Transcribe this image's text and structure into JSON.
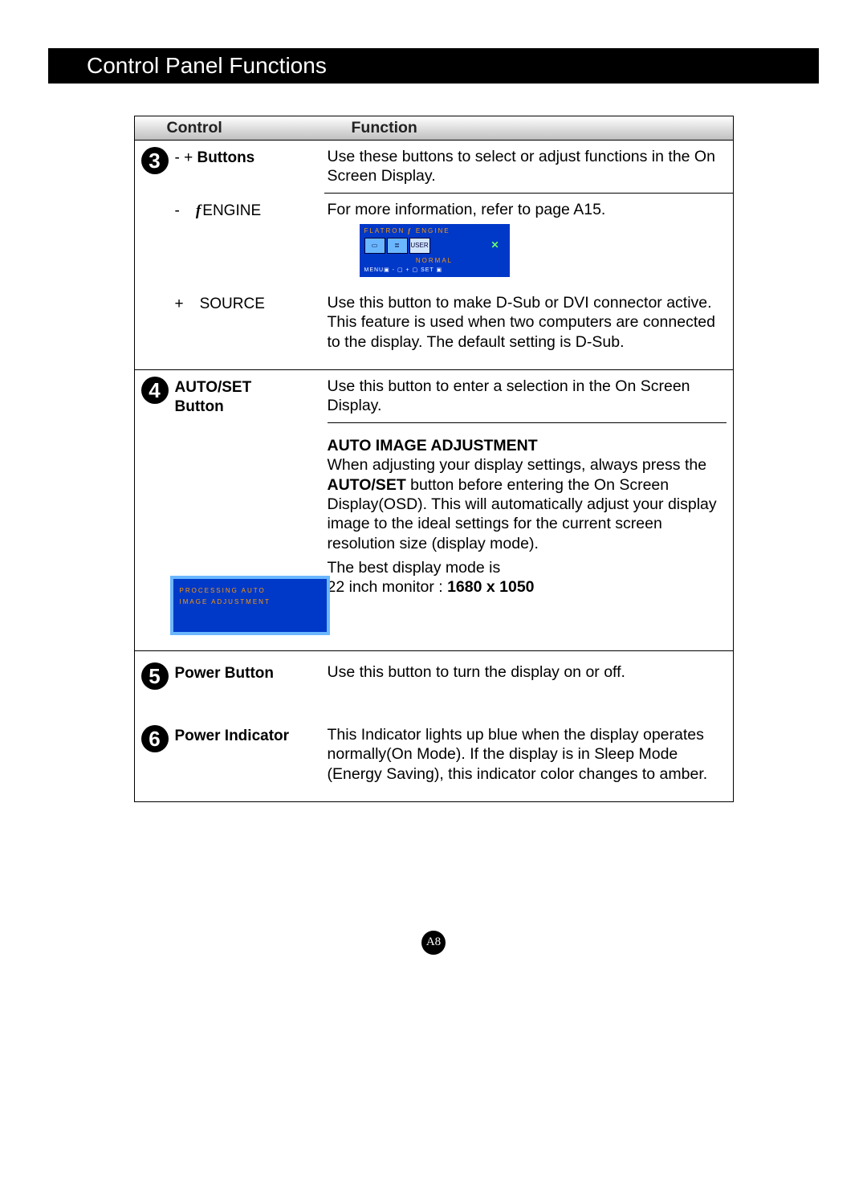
{
  "title": "Control Panel Functions",
  "header": {
    "control": "Control",
    "function": "Function"
  },
  "row3": {
    "num": "3",
    "control": {
      "pre": "-  + ",
      "label": "Buttons"
    },
    "func": "Use these buttons to select or adjust functions in the On Screen Display.",
    "sub": [
      {
        "sign": "-",
        "label_engine": "ENGINE",
        "func": "For more information, refer to page A15."
      },
      {
        "sign": "+",
        "label": "SOURCE",
        "func": "Use this button to make D-Sub or DVI connector active. This feature is used when two computers are connected to the display. The default setting is D-Sub."
      }
    ]
  },
  "osd1": {
    "title_l": "FLATRON",
    "title_r": "ENGINE",
    "user": "USER",
    "normal": "NORMAL",
    "menuline": "MENU▣   -  ▢   +  ▢   SET ▣"
  },
  "row4": {
    "num": "4",
    "control_l1": "AUTO/SET",
    "control_l2": "Button",
    "func1": "Use this button to enter a selection in the On Screen Display.",
    "heading": "AUTO IMAGE ADJUSTMENT",
    "para_a": "When adjusting your display settings, always press the ",
    "para_bold": "AUTO/SET",
    "para_b": " button before entering the On Screen Display(OSD). This will automatically adjust your display image to the ideal settings for the current screen resolution size (display mode).",
    "best_intro": "The best display mode is",
    "best_line_a": "22 inch monitor : ",
    "best_line_b": "1680 x 1050"
  },
  "osd2": {
    "l1": "PROCESSING AUTO",
    "l2": "IMAGE ADJUSTMENT"
  },
  "row5": {
    "num": "5",
    "control": "Power Button",
    "func": "Use this button to turn the display on or off."
  },
  "row6": {
    "num": "6",
    "control": "Power Indicator",
    "func": "This Indicator lights up blue when the display operates normally(On Mode). If the display is in Sleep Mode (Energy Saving), this indicator color changes to amber."
  },
  "pagefoot": "A8"
}
